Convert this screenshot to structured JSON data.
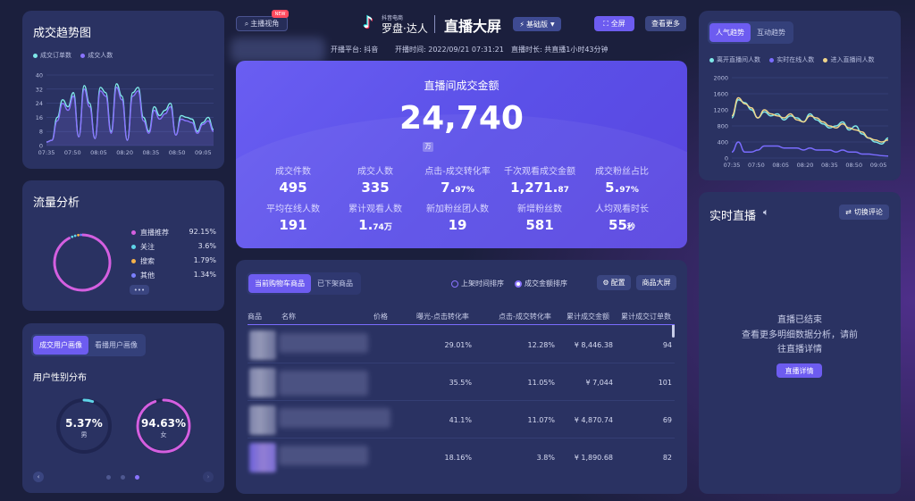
{
  "header": {
    "live_angle_label": "主播视角",
    "new_badge": "NEW",
    "brand_small": "抖音电商",
    "brand_name": "罗盘·达人",
    "screen_title": "直播大屏",
    "edition": "基础版",
    "fullscreen": "全屏",
    "view_more": "查看更多",
    "platform": "开播平台: 抖音",
    "start_time": "开播时间: 2022/09/21 07:31:21",
    "duration": "直播时长: 共直播1小时43分钟"
  },
  "trend": {
    "title": "成交趋势图",
    "legend": [
      "成交订单数",
      "成交人数"
    ],
    "colors": [
      "#7fe8e8",
      "#8a74ff"
    ]
  },
  "traffic": {
    "title": "流量分析",
    "items": [
      {
        "name": "直播推荐",
        "pct": "92.15%",
        "color": "#d45fe0"
      },
      {
        "name": "关注",
        "pct": "3.6%",
        "color": "#5fd4e8"
      },
      {
        "name": "搜索",
        "pct": "1.79%",
        "color": "#f5b24a"
      },
      {
        "name": "其他",
        "pct": "1.34%",
        "color": "#7a7fff"
      }
    ],
    "more": "•••"
  },
  "portrait": {
    "tabs": [
      "成交用户画像",
      "看播用户画像"
    ],
    "subtitle": "用户性别分布",
    "male_pct": "5.37%",
    "male_label": "男",
    "female_pct": "94.63%",
    "female_label": "女",
    "male_value": 5.37,
    "female_value": 94.63
  },
  "gmv": {
    "title": "直播间成交金额",
    "value": "24,740",
    "unit": "万",
    "metrics": [
      {
        "label": "成交件数",
        "value": "495",
        "suffix": ""
      },
      {
        "label": "成交人数",
        "value": "335",
        "suffix": ""
      },
      {
        "label": "点击-成交转化率",
        "value": "7.",
        "suffix": "97%"
      },
      {
        "label": "千次观看成交金额",
        "value": "1,271.",
        "suffix": "87"
      },
      {
        "label": "成交粉丝占比",
        "value": "5.",
        "suffix": "97%"
      },
      {
        "label": "平均在线人数",
        "value": "191",
        "suffix": ""
      },
      {
        "label": "累计观看人数",
        "value": "1.",
        "suffix": "74万"
      },
      {
        "label": "新加粉丝团人数",
        "value": "19",
        "suffix": ""
      },
      {
        "label": "新增粉丝数",
        "value": "581",
        "suffix": ""
      },
      {
        "label": "人均观看时长",
        "value": "55",
        "suffix": "秒"
      }
    ]
  },
  "products": {
    "tabs": [
      "当前购物车商品",
      "已下架商品"
    ],
    "sort": [
      "上架时间排序",
      "成交金额排序"
    ],
    "config": "配置",
    "big_screen": "商品大屏",
    "columns": [
      "商品",
      "名称",
      "价格",
      "曝光-点击转化率",
      "点击-成交转化率",
      "累计成交金额",
      "累计成交订单数"
    ],
    "rows": [
      {
        "ctr": "29.01%",
        "cvr": "12.28%",
        "gmv": "¥ 8,446.38",
        "orders": "94"
      },
      {
        "ctr": "35.5%",
        "cvr": "11.05%",
        "gmv": "¥ 7,044",
        "orders": "101"
      },
      {
        "ctr": "41.1%",
        "cvr": "11.07%",
        "gmv": "¥ 4,870.74",
        "orders": "69"
      },
      {
        "ctr": "18.16%",
        "cvr": "3.8%",
        "gmv": "¥ 1,890.68",
        "orders": "82"
      }
    ]
  },
  "popularity": {
    "tabs": [
      "人气趋势",
      "互动趋势"
    ],
    "legend": [
      "离开直播间人数",
      "实时在线人数",
      "进入直播间人数"
    ],
    "colors": [
      "#7fe8e8",
      "#7a6cff",
      "#f0d58a"
    ]
  },
  "live": {
    "title": "实时直播",
    "switch": "切换评论",
    "ended": "直播已结束",
    "hint1": "查看更多明细数据分析，请前",
    "hint2": "往直播详情",
    "detail": "直播详情"
  },
  "chart_data": [
    {
      "type": "line",
      "title": "成交趋势图",
      "x": [
        "07:35",
        "07:50",
        "08:05",
        "08:20",
        "08:35",
        "08:50",
        "09:05"
      ],
      "ylim": [
        0,
        40
      ],
      "yticks": [
        0,
        8,
        16,
        24,
        32,
        40
      ],
      "series": [
        {
          "name": "成交订单数",
          "values": [
            2,
            3,
            16,
            26,
            22,
            30,
            5,
            34,
            24,
            4,
            33,
            30,
            8,
            35,
            28,
            3,
            30,
            33,
            16,
            8,
            22,
            17,
            20,
            24,
            6,
            17,
            16,
            15,
            8,
            13,
            16,
            9
          ]
        },
        {
          "name": "成交人数",
          "values": [
            2,
            3,
            14,
            24,
            20,
            28,
            5,
            32,
            22,
            4,
            31,
            28,
            7,
            33,
            26,
            3,
            28,
            31,
            14,
            7,
            20,
            15,
            18,
            22,
            6,
            15,
            14,
            13,
            7,
            12,
            14,
            8
          ]
        }
      ]
    },
    {
      "type": "pie",
      "title": "流量分析",
      "categories": [
        "直播推荐",
        "关注",
        "搜索",
        "其他"
      ],
      "values": [
        92.15,
        3.6,
        1.79,
        1.34
      ]
    },
    {
      "type": "line",
      "x": [
        "07:35",
        "07:50",
        "08:05",
        "08:20",
        "08:35",
        "08:50",
        "09:05"
      ],
      "ylim": [
        0,
        2000
      ],
      "yticks": [
        0,
        400,
        800,
        1200,
        1600,
        2000
      ],
      "series": [
        {
          "name": "离开直播间人数",
          "values": [
            1000,
            1450,
            1380,
            1200,
            1000,
            1150,
            1050,
            1100,
            950,
            1050,
            1000,
            900,
            1100,
            950,
            850,
            750,
            800,
            900,
            700,
            800,
            600,
            500,
            400,
            350,
            500
          ]
        },
        {
          "name": "实时在线人数",
          "values": [
            150,
            400,
            150,
            150,
            200,
            300,
            300,
            300,
            250,
            250,
            250,
            200,
            250,
            200,
            200,
            200,
            150,
            200,
            150,
            150,
            100,
            100,
            80,
            60,
            50
          ]
        },
        {
          "name": "进入直播间人数",
          "values": [
            1050,
            1500,
            1350,
            1250,
            1000,
            1200,
            1100,
            1050,
            1000,
            1100,
            950,
            900,
            1050,
            1000,
            900,
            800,
            750,
            850,
            750,
            700,
            650,
            500,
            450,
            400,
            450
          ]
        }
      ]
    }
  ]
}
